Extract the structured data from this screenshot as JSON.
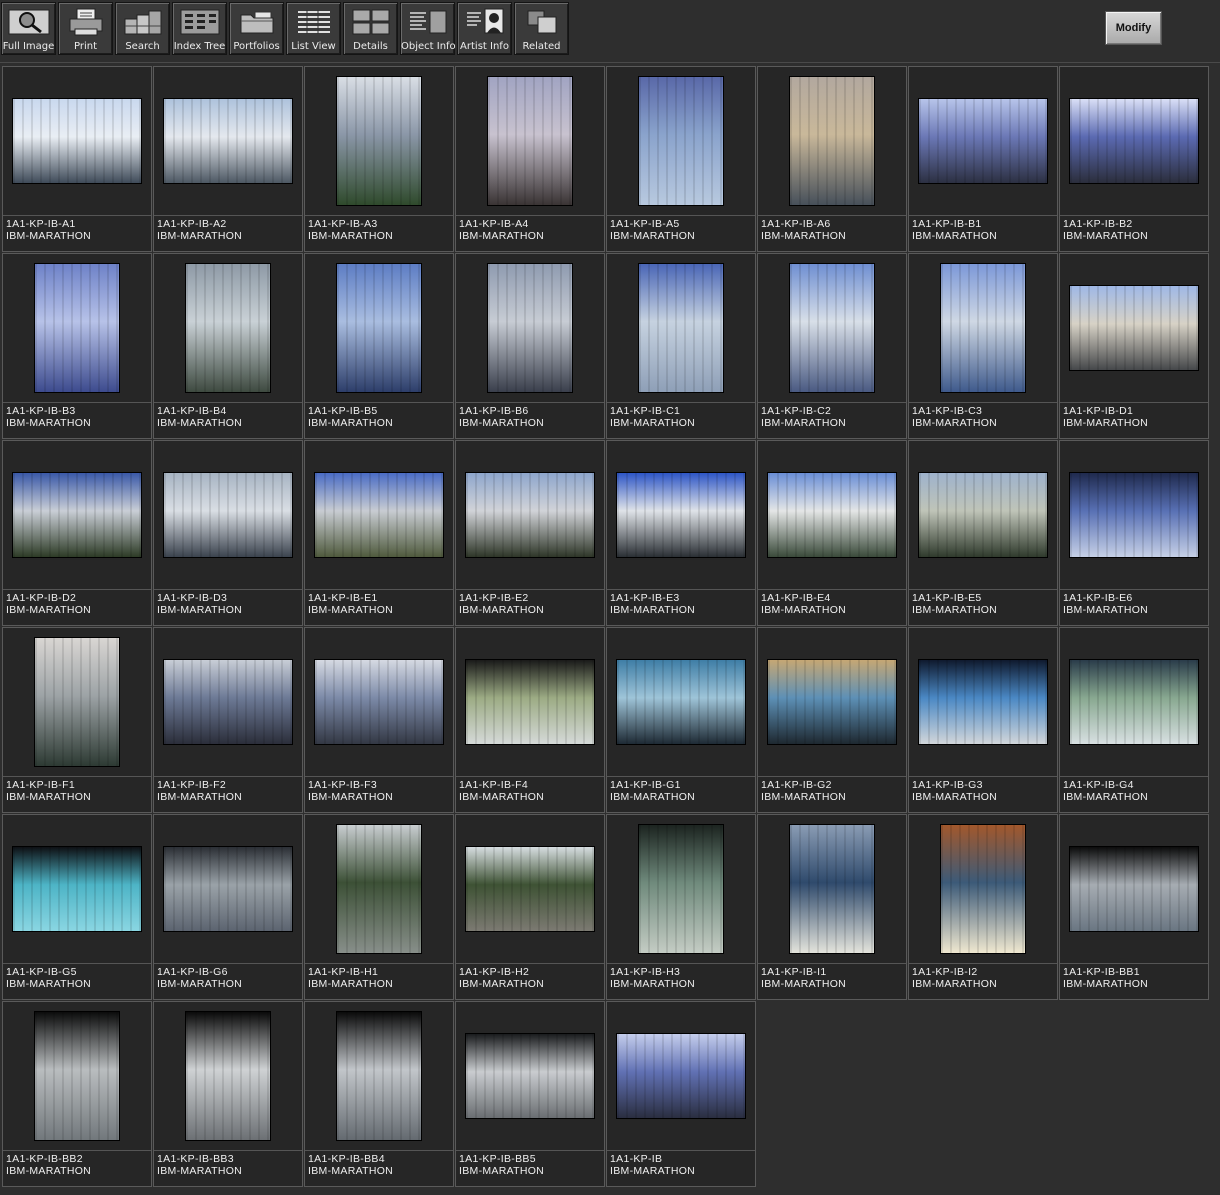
{
  "toolbar": {
    "buttons": [
      {
        "label": "Full Image",
        "icon": "magnifier-icon"
      },
      {
        "label": "Print",
        "icon": "printer-icon"
      },
      {
        "label": "Search",
        "icon": "search-grid-icon"
      },
      {
        "label": "Index Tree",
        "icon": "index-tree-icon"
      },
      {
        "label": "Portfolios",
        "icon": "folder-icon"
      },
      {
        "label": "List View",
        "icon": "list-view-icon"
      },
      {
        "label": "Details",
        "icon": "details-grid-icon"
      },
      {
        "label": "Object Info",
        "icon": "object-info-icon"
      },
      {
        "label": "Artist  Info",
        "icon": "artist-portrait-icon"
      },
      {
        "label": "Related",
        "icon": "related-squares-icon"
      }
    ],
    "modify_label": "Modify"
  },
  "colors": {
    "background": "#2e2e2e",
    "tile_background": "#262626",
    "tile_border": "#5a5a5a",
    "caption_text": "#f0f0f0"
  },
  "items": [
    {
      "code": "1A1-KP-IB-A1",
      "project": "IBM-MARATHON",
      "orientation": "landscape",
      "palette": [
        "#c9d8ee",
        "#e9eef4",
        "#3f4b59"
      ]
    },
    {
      "code": "1A1-KP-IB-A2",
      "project": "IBM-MARATHON",
      "orientation": "landscape",
      "palette": [
        "#aec2dc",
        "#e4e8ee",
        "#4d5863"
      ]
    },
    {
      "code": "1A1-KP-IB-A3",
      "project": "IBM-MARATHON",
      "orientation": "portrait",
      "palette": [
        "#d9dee5",
        "#8b97a8",
        "#2f4a2c"
      ]
    },
    {
      "code": "1A1-KP-IB-A4",
      "project": "IBM-MARATHON",
      "orientation": "portrait",
      "palette": [
        "#a1a4c2",
        "#c8c2cf",
        "#3a3434"
      ]
    },
    {
      "code": "1A1-KP-IB-A5",
      "project": "IBM-MARATHON",
      "orientation": "portrait",
      "palette": [
        "#5968a8",
        "#8aa3cc",
        "#b8c9df"
      ]
    },
    {
      "code": "1A1-KP-IB-A6",
      "project": "IBM-MARATHON",
      "orientation": "portrait",
      "palette": [
        "#b2a89e",
        "#c9b89a",
        "#47505a"
      ]
    },
    {
      "code": "1A1-KP-IB-B1",
      "project": "IBM-MARATHON",
      "orientation": "landscape",
      "palette": [
        "#b7c4ea",
        "#6b78b6",
        "#2c3042"
      ]
    },
    {
      "code": "1A1-KP-IB-B2",
      "project": "IBM-MARATHON",
      "orientation": "landscape",
      "palette": [
        "#d9dff6",
        "#5b6ab2",
        "#2b2e3c"
      ]
    },
    {
      "code": "1A1-KP-IB-B3",
      "project": "IBM-MARATHON",
      "orientation": "portrait",
      "palette": [
        "#6e82c8",
        "#b7c2e8",
        "#3d4b8e"
      ]
    },
    {
      "code": "1A1-KP-IB-B4",
      "project": "IBM-MARATHON",
      "orientation": "portrait",
      "palette": [
        "#8e9aa6",
        "#c9d1d6",
        "#3e4a40"
      ]
    },
    {
      "code": "1A1-KP-IB-B5",
      "project": "IBM-MARATHON",
      "orientation": "portrait",
      "palette": [
        "#5d7dc4",
        "#a9bde0",
        "#2d3e6a"
      ]
    },
    {
      "code": "1A1-KP-IB-B6",
      "project": "IBM-MARATHON",
      "orientation": "portrait",
      "palette": [
        "#8f9bb0",
        "#c7ccd4",
        "#3a3f4c"
      ]
    },
    {
      "code": "1A1-KP-IB-C1",
      "project": "IBM-MARATHON",
      "orientation": "portrait",
      "palette": [
        "#4a66b6",
        "#c6d2e0",
        "#8e9fb7"
      ]
    },
    {
      "code": "1A1-KP-IB-C2",
      "project": "IBM-MARATHON",
      "orientation": "portrait",
      "palette": [
        "#6f8fd2",
        "#d8dfe8",
        "#4a5a82"
      ]
    },
    {
      "code": "1A1-KP-IB-C3",
      "project": "IBM-MARATHON",
      "orientation": "portrait",
      "palette": [
        "#7c98d8",
        "#cfd8e4",
        "#3f5a8c"
      ]
    },
    {
      "code": "1A1-KP-IB-D1",
      "project": "IBM-MARATHON",
      "orientation": "landscape",
      "palette": [
        "#9fb8e6",
        "#d7d2c6",
        "#45474a"
      ]
    },
    {
      "code": "1A1-KP-IB-D2",
      "project": "IBM-MARATHON",
      "orientation": "landscape",
      "palette": [
        "#3a59a8",
        "#c9ced6",
        "#2d3b26"
      ]
    },
    {
      "code": "1A1-KP-IB-D3",
      "project": "IBM-MARATHON",
      "orientation": "landscape",
      "palette": [
        "#a7b4c3",
        "#d9dee4",
        "#3b434e"
      ]
    },
    {
      "code": "1A1-KP-IB-E1",
      "project": "IBM-MARATHON",
      "orientation": "landscape",
      "palette": [
        "#4a6cc4",
        "#c8ccd2",
        "#4f5a3d"
      ]
    },
    {
      "code": "1A1-KP-IB-E2",
      "project": "IBM-MARATHON",
      "orientation": "landscape",
      "palette": [
        "#8ea6cc",
        "#d1d3d8",
        "#2e3628"
      ]
    },
    {
      "code": "1A1-KP-IB-E3",
      "project": "IBM-MARATHON",
      "orientation": "landscape",
      "palette": [
        "#2e56c6",
        "#dfe3e8",
        "#2a2f34"
      ]
    },
    {
      "code": "1A1-KP-IB-E4",
      "project": "IBM-MARATHON",
      "orientation": "landscape",
      "palette": [
        "#6a8ed6",
        "#e4e6e6",
        "#3a4a3a"
      ]
    },
    {
      "code": "1A1-KP-IB-E5",
      "project": "IBM-MARATHON",
      "orientation": "landscape",
      "palette": [
        "#9eb2cc",
        "#bfc4b8",
        "#2f3a2c"
      ]
    },
    {
      "code": "1A1-KP-IB-E6",
      "project": "IBM-MARATHON",
      "orientation": "landscape",
      "palette": [
        "#1f2a4e",
        "#5870b4",
        "#c6d0e6"
      ]
    },
    {
      "code": "1A1-KP-IB-F1",
      "project": "IBM-MARATHON",
      "orientation": "portrait",
      "palette": [
        "#d9d6d3",
        "#9da3a6",
        "#2d3a33"
      ]
    },
    {
      "code": "1A1-KP-IB-F2",
      "project": "IBM-MARATHON",
      "orientation": "landscape",
      "palette": [
        "#c8cdd6",
        "#6d7a96",
        "#2b2e3a"
      ]
    },
    {
      "code": "1A1-KP-IB-F3",
      "project": "IBM-MARATHON",
      "orientation": "landscape",
      "palette": [
        "#d5d9e2",
        "#7c8aa8",
        "#333844"
      ]
    },
    {
      "code": "1A1-KP-IB-F4",
      "project": "IBM-MARATHON",
      "orientation": "landscape",
      "palette": [
        "#1a1a1a",
        "#9cab84",
        "#d5d9d8"
      ]
    },
    {
      "code": "1A1-KP-IB-G1",
      "project": "IBM-MARATHON",
      "orientation": "landscape",
      "palette": [
        "#3f7ea6",
        "#9ec4d8",
        "#1e2a34"
      ]
    },
    {
      "code": "1A1-KP-IB-G2",
      "project": "IBM-MARATHON",
      "orientation": "landscape",
      "palette": [
        "#c5a774",
        "#5d90b6",
        "#1e2830"
      ]
    },
    {
      "code": "1A1-KP-IB-G3",
      "project": "IBM-MARATHON",
      "orientation": "landscape",
      "palette": [
        "#0f1a2e",
        "#4a88c4",
        "#d2d6da"
      ]
    },
    {
      "code": "1A1-KP-IB-G4",
      "project": "IBM-MARATHON",
      "orientation": "landscape",
      "palette": [
        "#2a3c4a",
        "#88a890",
        "#d8e0e2"
      ]
    },
    {
      "code": "1A1-KP-IB-G5",
      "project": "IBM-MARATHON",
      "orientation": "landscape",
      "palette": [
        "#0e1014",
        "#4db4c6",
        "#8ad6e2"
      ]
    },
    {
      "code": "1A1-KP-IB-G6",
      "project": "IBM-MARATHON",
      "orientation": "landscape",
      "palette": [
        "#2c3036",
        "#9aa2a8",
        "#5c6470"
      ]
    },
    {
      "code": "1A1-KP-IB-H1",
      "project": "IBM-MARATHON",
      "orientation": "portrait",
      "palette": [
        "#c8cdd0",
        "#3c5036",
        "#888f8a"
      ]
    },
    {
      "code": "1A1-KP-IB-H2",
      "project": "IBM-MARATHON",
      "orientation": "landscape",
      "palette": [
        "#d6dde0",
        "#3e5234",
        "#7c7a72"
      ]
    },
    {
      "code": "1A1-KP-IB-H3",
      "project": "IBM-MARATHON",
      "orientation": "portrait",
      "palette": [
        "#1c2420",
        "#6f8a7c",
        "#c4ccc4"
      ]
    },
    {
      "code": "1A1-KP-IB-I1",
      "project": "IBM-MARATHON",
      "orientation": "portrait",
      "palette": [
        "#8a9cb4",
        "#2f4a6c",
        "#e4e4dc"
      ]
    },
    {
      "code": "1A1-KP-IB-I2",
      "project": "IBM-MARATHON",
      "orientation": "portrait",
      "palette": [
        "#a2582c",
        "#3c5a78",
        "#f0e8d0"
      ]
    },
    {
      "code": "1A1-KP-IB-BB1",
      "project": "IBM-MARATHON",
      "orientation": "landscape",
      "palette": [
        "#0c0c0c",
        "#a6acb2",
        "#6a7682"
      ]
    },
    {
      "code": "1A1-KP-IB-BB2",
      "project": "IBM-MARATHON",
      "orientation": "portrait",
      "palette": [
        "#0c0c0c",
        "#b9bdbf",
        "#72787c"
      ]
    },
    {
      "code": "1A1-KP-IB-BB3",
      "project": "IBM-MARATHON",
      "orientation": "portrait",
      "palette": [
        "#0a0a0a",
        "#cfd2d4",
        "#6c7074"
      ]
    },
    {
      "code": "1A1-KP-IB-BB4",
      "project": "IBM-MARATHON",
      "orientation": "portrait",
      "palette": [
        "#0a0a0a",
        "#c2c6ca",
        "#646a70"
      ]
    },
    {
      "code": "1A1-KP-IB-BB5",
      "project": "IBM-MARATHON",
      "orientation": "landscape",
      "palette": [
        "#1a1c1e",
        "#c9cccf",
        "#6a6e72"
      ]
    },
    {
      "code": "1A1-KP-IB",
      "project": "IBM-MARATHON",
      "orientation": "landscape",
      "palette": [
        "#c4cdec",
        "#6171b4",
        "#2a2e40"
      ]
    }
  ]
}
